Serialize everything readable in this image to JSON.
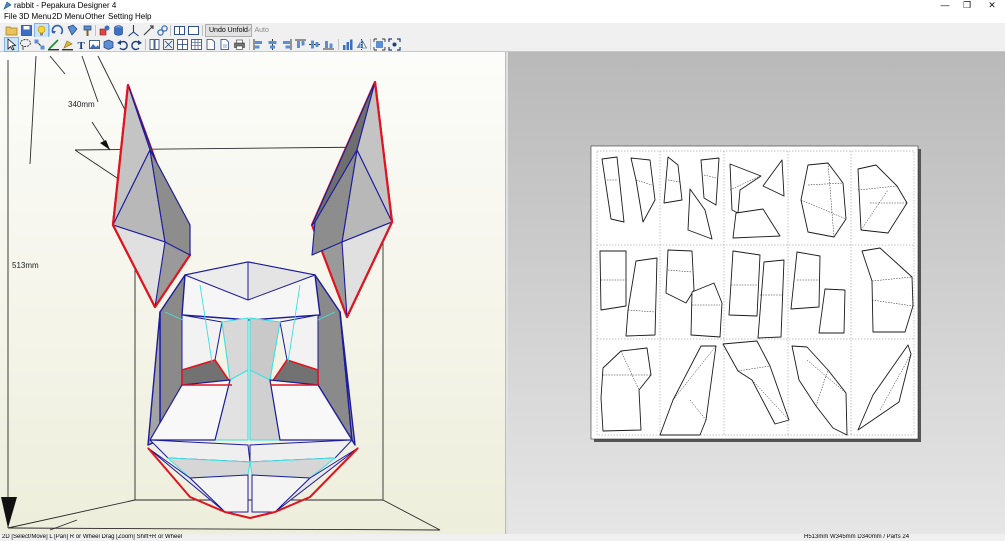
{
  "window": {
    "title": "rabbit - Pepakura Designer 4",
    "minimize": "—",
    "restore": "❐",
    "close": "✕"
  },
  "menu": [
    "File",
    "3D Menu",
    "2D Menu",
    "Other",
    "Setting",
    "Help"
  ],
  "toolbar": {
    "undo_unfold_label": "Undo Unfold",
    "auto_label": "Auto"
  },
  "view3d": {
    "width_label": "340mm",
    "height_label": "513mm"
  },
  "status": {
    "left": "2D [Select/Move] L [Pan] R or Wheel Drag [Zoom] Shift+R or Wheel",
    "right": "H513mm W345mm D340mm / Parts 24"
  },
  "colors": {
    "cut_edge": "#e0141e",
    "mountain_fold": "#1c1c9c",
    "valley_fold": "#40e0e0",
    "selected_tool": "#cce4f7"
  },
  "icons": {
    "app": "pepakura-icon",
    "toolbar_row1": [
      "open-icon",
      "save-icon",
      "light-icon",
      "rotate-icon",
      "unfold-icon",
      "paint-icon",
      "texture-icon",
      "axis-icon",
      "link-icon",
      "split-view-icon",
      "single-view-icon"
    ],
    "toolbar_row2": [
      "select-icon",
      "lasso-icon",
      "arrange-icon",
      "edge-icon",
      "paint-icon",
      "text-icon",
      "image-icon",
      "box-icon",
      "undo-icon",
      "redo-icon",
      "page-icon",
      "zoom-fit-icon",
      "grid-icon",
      "table-icon",
      "page-setup-icon",
      "page2-icon",
      "print-icon",
      "align-left-icon",
      "align-center-icon",
      "align-right-icon",
      "align-top-icon",
      "align-middle-icon",
      "align-bottom-icon",
      "chart-icon",
      "flip-icon",
      "fit-icon",
      "fullscreen-icon"
    ]
  }
}
